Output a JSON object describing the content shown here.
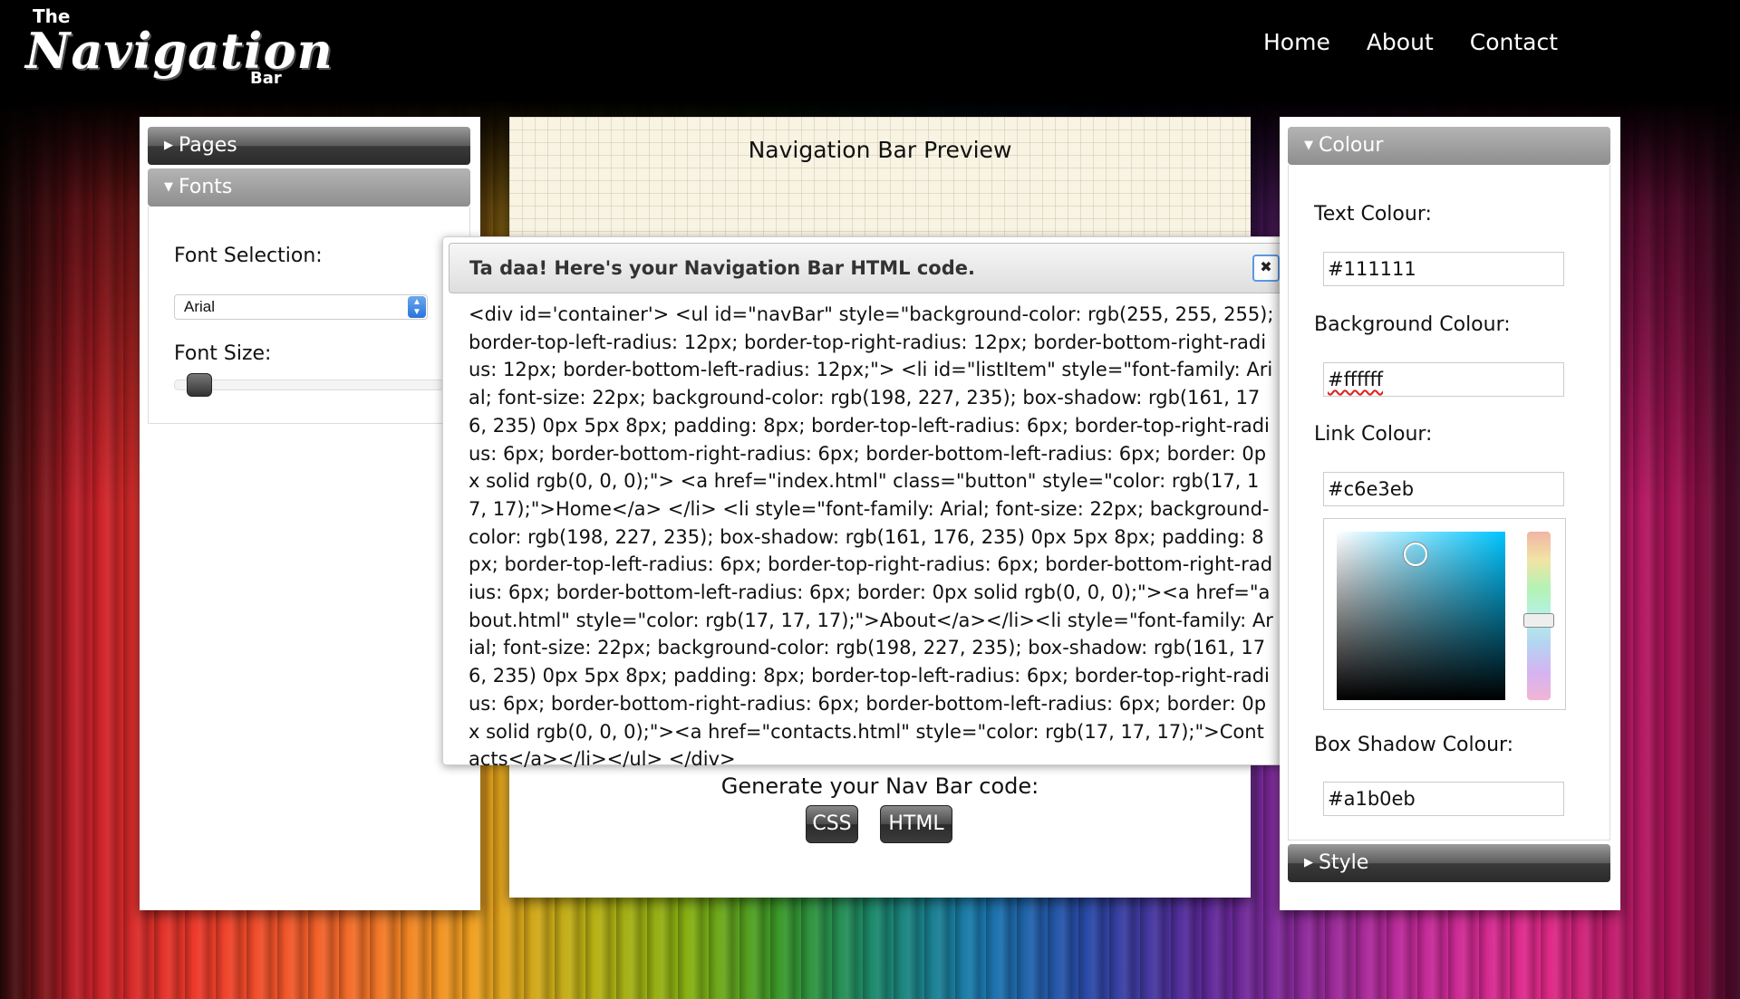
{
  "app": {
    "logo": {
      "the": "The",
      "main": "Navigation",
      "bar": "Bar"
    },
    "nav": [
      "Home",
      "About",
      "Contact"
    ]
  },
  "left_panel": {
    "pages_label": "Pages",
    "fonts_label": "Fonts",
    "font_selection_label": "Font Selection:",
    "font_value": "Arial",
    "font_size_label": "Font Size:",
    "font_size_value": 0.05
  },
  "center_panel": {
    "title": "Navigation Bar Preview",
    "generate_label": "Generate your Nav Bar code:",
    "css_button": "CSS",
    "html_button": "HTML"
  },
  "dialog": {
    "title": "Ta daa! Here's your Navigation Bar HTML code.",
    "close_label": "✖",
    "code": "<div id='container'> <ul id=\"navBar\" style=\"background-color: rgb(255, 255, 255); border-top-left-radius: 12px; border-top-right-radius: 12px; border-bottom-right-radius: 12px; border-bottom-left-radius: 12px;\"> <li id=\"listItem\" style=\"font-family: Arial; font-size: 22px; background-color: rgb(198, 227, 235); box-shadow: rgb(161, 176, 235) 0px 5px 8px; padding: 8px; border-top-left-radius: 6px; border-top-right-radius: 6px; border-bottom-right-radius: 6px; border-bottom-left-radius: 6px; border: 0px solid rgb(0, 0, 0);\"> <a href=\"index.html\" class=\"button\" style=\"color: rgb(17, 17, 17);\">Home</a> </li> <li style=\"font-family: Arial; font-size: 22px; background-color: rgb(198, 227, 235); box-shadow: rgb(161, 176, 235) 0px 5px 8px; padding: 8px; border-top-left-radius: 6px; border-top-right-radius: 6px; border-bottom-right-radius: 6px; border-bottom-left-radius: 6px; border: 0px solid rgb(0, 0, 0);\"><a href=\"about.html\" style=\"color: rgb(17, 17, 17);\">About</a></li><li style=\"font-family: Arial; font-size: 22px; background-color: rgb(198, 227, 235); box-shadow: rgb(161, 176, 235) 0px 5px 8px; padding: 8px; border-top-left-radius: 6px; border-top-right-radius: 6px; border-bottom-right-radius: 6px; border-bottom-left-radius: 6px; border: 0px solid rgb(0, 0, 0);\"><a href=\"contacts.html\" style=\"color: rgb(17, 17, 17);\">Contacts</a></li></ul> </div>"
  },
  "right_panel": {
    "colour_label": "Colour",
    "text_colour_label": "Text Colour:",
    "text_colour_value": "#111111",
    "background_colour_label": "Background Colour:",
    "background_colour_value": "#ffffff",
    "link_colour_label": "Link Colour:",
    "link_colour_value": "#c6e3eb",
    "box_shadow_colour_label": "Box Shadow Colour:",
    "box_shadow_colour_value": "#a1b0eb",
    "style_label": "Style"
  },
  "icons": {
    "caret_right": "caret-right-icon",
    "caret_down": "caret-down-icon",
    "close": "close-icon",
    "select_arrows": "select-arrows-icon"
  }
}
